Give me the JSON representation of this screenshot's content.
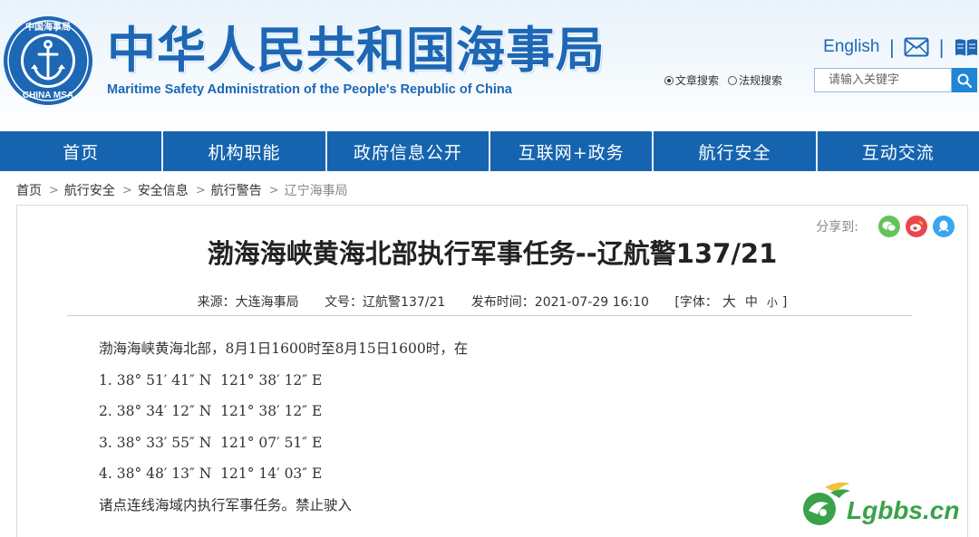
{
  "header": {
    "logo_top_text": "中国海事局",
    "logo_bottom_text": "CHINA MSA",
    "title_cn": "中华人民共和国海事局",
    "title_en": "Maritime Safety Administration of the People's Republic of China",
    "english_link": "English",
    "separator": "|",
    "search": {
      "option_article": "文章搜索",
      "option_regulation": "法规搜索",
      "selected": "文章搜索",
      "placeholder": "请输入关键字"
    }
  },
  "nav": {
    "items": [
      "首页",
      "机构职能",
      "政府信息公开",
      "互联网+政务",
      "航行安全",
      "互动交流"
    ]
  },
  "breadcrumb": {
    "items": [
      "首页",
      "航行安全",
      "安全信息",
      "航行警告",
      "辽宁海事局"
    ],
    "separator": ">"
  },
  "article": {
    "share_label": "分享到:",
    "share_icons": [
      "wechat-icon",
      "weibo-icon",
      "qq-icon"
    ],
    "title": "渤海海峡黄海北部执行军事任务--辽航警137/21",
    "meta": {
      "source": "来源：大连海事局",
      "doc_no": "文号：辽航警137/21",
      "published": "发布时间：2021-07-29 16:10",
      "font_label": "[字体：",
      "font_large": "大",
      "font_medium": "中",
      "font_small": "小",
      "font_close": "]"
    },
    "lines": [
      "渤海海峡黄海北部，8月1日1600时至8月15日1600时，在",
      "1. 38° 51′ 41″ N  121° 38′ 12″ E",
      "2. 38° 34′ 12″ N  121° 38′ 12″ E",
      "3. 38° 33′ 55″ N  121° 07′ 51″ E",
      "4. 38° 48′ 13″ N  121° 14′ 03″ E",
      "诸点连线海域内执行军事任务。禁止驶入"
    ]
  },
  "watermark": {
    "text": "Lgbbs.cn"
  },
  "colors": {
    "brand_blue": "#1d67b5",
    "nav_blue": "#1664b0",
    "search_button": "#1f86d6",
    "wechat": "#62c35a",
    "weibo": "#e8474b",
    "qq": "#3aa5f0"
  }
}
